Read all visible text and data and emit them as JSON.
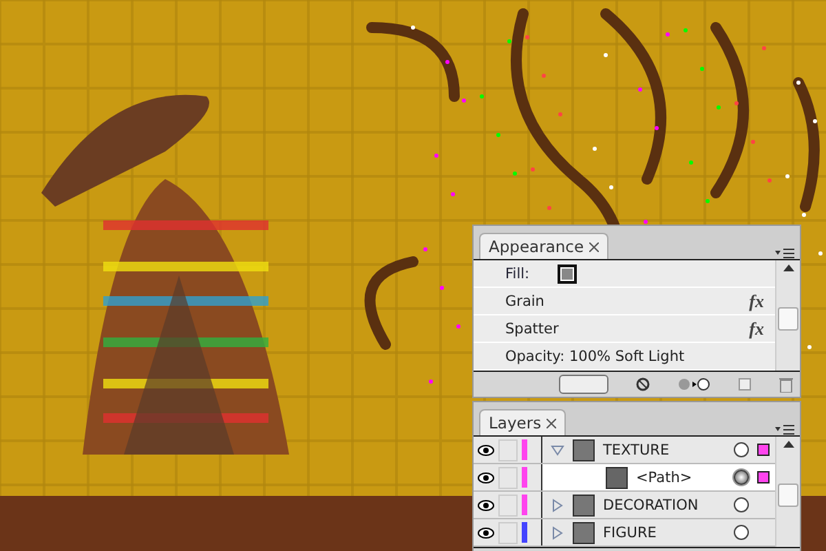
{
  "appearance": {
    "title": "Appearance",
    "items": [
      {
        "kind": "fill",
        "label": "Fill:"
      },
      {
        "kind": "effect",
        "label": "Grain",
        "fx": "fx"
      },
      {
        "kind": "effect",
        "label": "Spatter",
        "fx": "fx"
      },
      {
        "kind": "opacity",
        "label": "Opacity: 100% Soft Light"
      }
    ]
  },
  "layers": {
    "title": "Layers",
    "items": [
      {
        "name": "TEXTURE",
        "color": "#ff44ee",
        "visible": true,
        "expanded": true,
        "selected": false,
        "targeted": false,
        "children": [
          {
            "name": "<Path>",
            "color": "#ff44ee",
            "visible": true,
            "selected": true,
            "targeted": true
          }
        ]
      },
      {
        "name": "DECORATION",
        "color": "#ff44ee",
        "visible": true,
        "expanded": false,
        "selected": false,
        "targeted": false
      },
      {
        "name": "FIGURE",
        "color": "#4444ff",
        "visible": true,
        "expanded": false,
        "selected": false,
        "targeted": false
      }
    ]
  }
}
